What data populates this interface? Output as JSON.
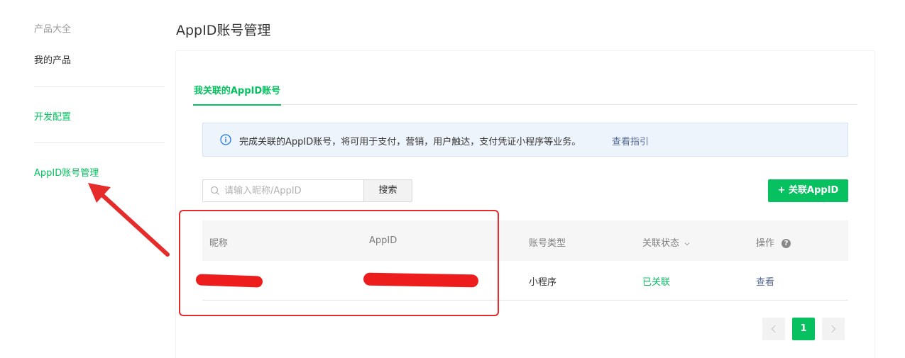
{
  "sidebar": {
    "section_title": "产品大全",
    "my_products": "我的产品",
    "dev_config": "开发配置",
    "appid_management": "AppID账号管理"
  },
  "page_title": "AppID账号管理",
  "tabs": [
    {
      "label": "我关联的AppID账号",
      "active": true
    }
  ],
  "notice": {
    "text": "完成关联的AppID账号，将可用于支付，营销，用户触达，支付凭证小程序等业务。",
    "link": "查看指引"
  },
  "search": {
    "placeholder": "请输入昵称/AppID",
    "button": "搜索"
  },
  "add_button": "+ 关联AppID",
  "table": {
    "headers": [
      "昵称",
      "AppID",
      "账号类型",
      "关联状态",
      "操作"
    ],
    "rows": [
      {
        "nickname": "",
        "appid": "",
        "type": "小程序",
        "status": "已关联",
        "action": "查看"
      }
    ]
  },
  "pagination": {
    "current": "1"
  },
  "colors": {
    "brand_green": "#07c160",
    "link_blue": "#576b95",
    "annotation_red": "#e62b2b"
  },
  "icons": {
    "notice": "info-circle-icon",
    "search": "magnifier-icon",
    "sort": "chevron-down-icon",
    "help": "question-circle-icon",
    "prev": "chevron-left-icon",
    "next": "chevron-right-icon"
  }
}
